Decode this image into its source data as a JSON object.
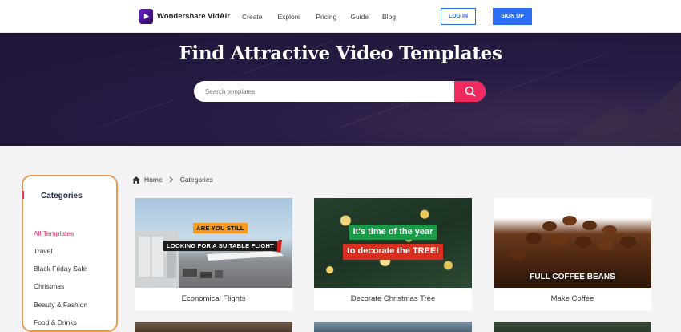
{
  "nav": {
    "brand": "Wondershare VidAir",
    "links": [
      "Create",
      "Explore",
      "Pricing",
      "Guide",
      "Blog"
    ],
    "login": "LOG IN",
    "signup": "SIGN UP"
  },
  "hero": {
    "title": "Find Attractive Video Templates",
    "search_placeholder": "Search templates"
  },
  "sidebar": {
    "title": "Categories",
    "items": [
      "All Templates",
      "Travel",
      "Black Friday Sale",
      "Christmas",
      "Beauty & Fashion",
      "Food & Drinks"
    ]
  },
  "breadcrumb": {
    "home": "Home",
    "current": "Categories"
  },
  "cards": [
    {
      "title": "Economical Flights",
      "overlay_line1": "ARE YOU STILL",
      "overlay_line2": "LOOKING FOR A SUITABLE FLIGHT"
    },
    {
      "title": "Decorate Christmas Tree",
      "overlay_line1": "It's time of the year",
      "overlay_line2": "to decorate the TREE!"
    },
    {
      "title": "Make Coffee",
      "overlay_line1": "FULL COFFEE BEANS"
    }
  ],
  "colors": {
    "accent": "#f0295f",
    "primary": "#2b6df5",
    "hero_bg": "#271b44",
    "highlight": "#e89a52"
  }
}
